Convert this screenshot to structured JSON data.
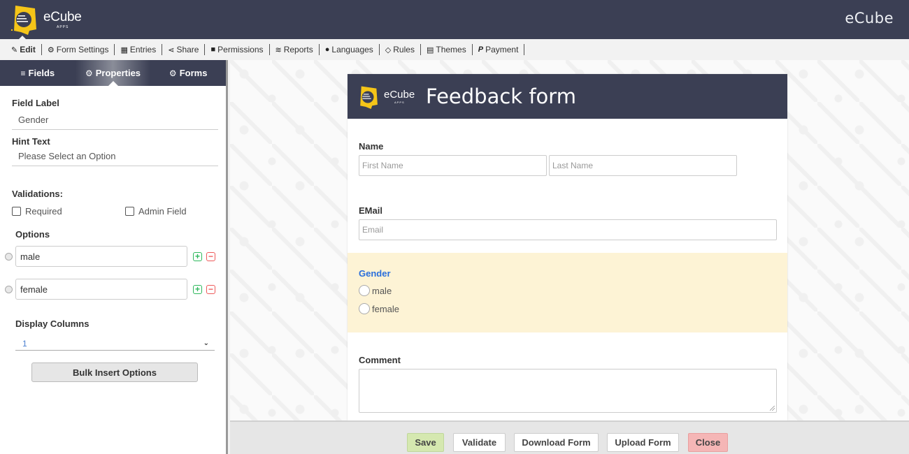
{
  "header": {
    "logo_text": "eCube",
    "logo_sub": "APPS",
    "brand_right": "eCube",
    "colors": {
      "header_bg": "#3b3f54",
      "logo_yellow": "#f5c518"
    }
  },
  "menu": {
    "items": [
      {
        "icon": "edit-icon",
        "glyph": "✎",
        "label": "Edit",
        "active": true
      },
      {
        "icon": "gear-icon",
        "glyph": "⚙",
        "label": "Form Settings"
      },
      {
        "icon": "table-icon",
        "glyph": "▦",
        "label": "Entries"
      },
      {
        "icon": "share-icon",
        "glyph": "⋖",
        "label": "Share"
      },
      {
        "icon": "lock-icon",
        "glyph": "🔒︎",
        "label": "Permissions"
      },
      {
        "icon": "database-icon",
        "glyph": "≋",
        "label": "Reports"
      },
      {
        "icon": "language-icon",
        "glyph": "●",
        "label": "Languages"
      },
      {
        "icon": "code-icon",
        "glyph": "◇",
        "label": "Rules"
      },
      {
        "icon": "theme-icon",
        "glyph": "▤",
        "label": "Themes"
      },
      {
        "icon": "paypal-icon",
        "glyph": "P",
        "label": "Payment"
      }
    ]
  },
  "sidebar": {
    "tabs": [
      {
        "icon": "bars-icon",
        "glyph": "≡",
        "label": "Fields"
      },
      {
        "icon": "cogs-icon",
        "glyph": "⚙",
        "label": "Properties",
        "active": true
      },
      {
        "icon": "gear-icon",
        "glyph": "⚙",
        "label": "Forms"
      }
    ],
    "field_label": {
      "label": "Field Label",
      "value": "Gender"
    },
    "hint_text": {
      "label": "Hint Text",
      "value": "Please Select an Option"
    },
    "validations": {
      "label": "Validations:",
      "required": {
        "label": "Required",
        "checked": false
      },
      "admin_field": {
        "label": "Admin Field",
        "checked": false
      }
    },
    "options": {
      "label": "Options",
      "items": [
        {
          "value": "male"
        },
        {
          "value": "female"
        }
      ],
      "add_glyph": "+",
      "remove_glyph": "−"
    },
    "display_columns": {
      "label": "Display Columns",
      "value": "1",
      "chevron": "⌄"
    },
    "bulk_insert_label": "Bulk Insert Options"
  },
  "form": {
    "logo_text": "eCube",
    "logo_sub": "APPS",
    "title": "Feedback form",
    "name": {
      "label": "Name",
      "first_placeholder": "First Name",
      "last_placeholder": "Last Name"
    },
    "email": {
      "label": "EMail",
      "placeholder": "Email"
    },
    "gender": {
      "label": "Gender",
      "options": [
        "male",
        "female"
      ],
      "highlight_color": "#fdf3d5"
    },
    "comment": {
      "label": "Comment",
      "value": ""
    }
  },
  "actions": {
    "save": "Save",
    "validate": "Validate",
    "download": "Download Form",
    "upload": "Upload Form",
    "close": "Close"
  }
}
